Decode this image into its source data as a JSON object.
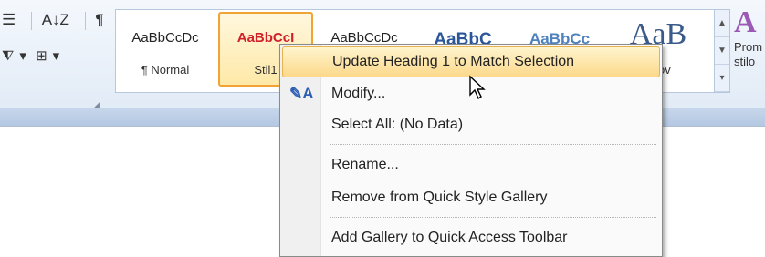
{
  "ribbon": {
    "paragraph_tools": {
      "sort": "A↓Z",
      "pilcrow": "¶",
      "shading": "⧨",
      "borders": "⊞",
      "dropdown": "▾"
    },
    "gallery": {
      "styles": [
        {
          "preview": "AaBbCcDc",
          "name": "¶ Normal"
        },
        {
          "preview": "AaBbCcI",
          "name": "Stil1"
        },
        {
          "preview": "AaBbCcDc",
          "name": ""
        },
        {
          "preview": "AaBbC",
          "name": ""
        },
        {
          "preview": "AaBbCc",
          "name": ""
        },
        {
          "preview": "AaB",
          "name": "...lov"
        }
      ]
    },
    "change_styles": {
      "glyph": "A",
      "label_line1": "Prom",
      "label_line2": "stilo"
    }
  },
  "context_menu": {
    "items": [
      {
        "label": "Update Heading 1 to Match Selection",
        "icon": ""
      },
      {
        "label": "Modify...",
        "icon": "modify-style-icon"
      },
      {
        "label": "Select All: (No Data)",
        "icon": ""
      },
      {
        "label": "Rename...",
        "icon": ""
      },
      {
        "label": "Remove from Quick Style Gallery",
        "icon": ""
      },
      {
        "label": "Add Gallery to Quick Access Toolbar",
        "icon": ""
      }
    ]
  },
  "colors": {
    "highlight": "#fcd98b",
    "accent": "#f0a436",
    "ribbon": "#dfe9f5"
  }
}
